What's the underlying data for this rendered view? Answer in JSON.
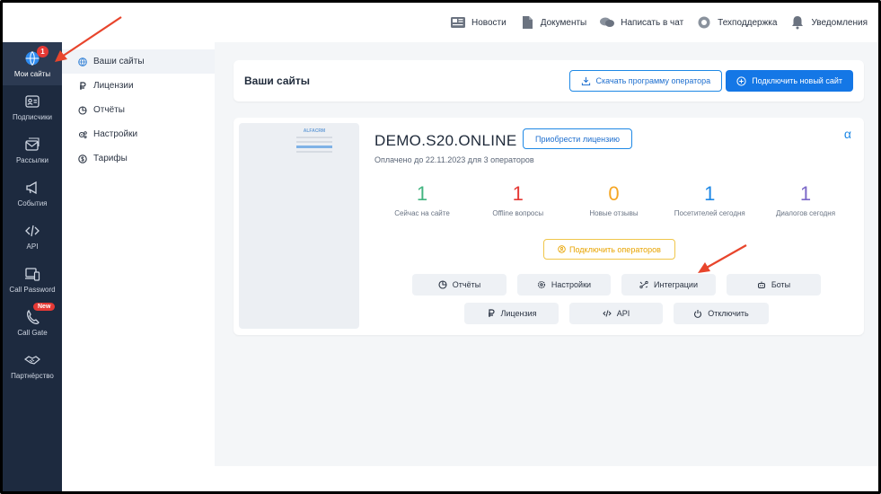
{
  "topbar": {
    "items": [
      {
        "label": "Новости",
        "icon": "news-icon"
      },
      {
        "label": "Документы",
        "icon": "document-icon"
      },
      {
        "label": "Написать в чат",
        "icon": "chat-icon"
      },
      {
        "label": "Техподдержка",
        "icon": "lifebuoy-icon"
      },
      {
        "label": "Уведомления",
        "icon": "bell-icon"
      }
    ]
  },
  "leftnav": {
    "items": [
      {
        "label": "Мои сайты",
        "icon": "globe-icon",
        "badge": "1"
      },
      {
        "label": "Подписчики",
        "icon": "contact-card-icon"
      },
      {
        "label": "Рассылки",
        "icon": "mail-icon"
      },
      {
        "label": "События",
        "icon": "megaphone-icon"
      },
      {
        "label": "API",
        "icon": "code-icon"
      },
      {
        "label": "Call Password",
        "icon": "devices-icon"
      },
      {
        "label": "Call Gate",
        "icon": "phone-icon",
        "badge": "New"
      },
      {
        "label": "Партнёрство",
        "icon": "handshake-icon"
      }
    ]
  },
  "subnav": {
    "items": [
      {
        "label": "Ваши сайты",
        "icon": "globe-icon"
      },
      {
        "label": "Лицензии",
        "icon": "ruble-icon"
      },
      {
        "label": "Отчёты",
        "icon": "pie-chart-icon"
      },
      {
        "label": "Настройки",
        "icon": "settings-icon"
      },
      {
        "label": "Тарифы",
        "icon": "dollar-icon"
      }
    ]
  },
  "header": {
    "title": "Ваши сайты",
    "download_label": "Скачать программу оператора",
    "connect_label": "Подключить новый сайт"
  },
  "site": {
    "name": "DEMO.S20.ONLINE",
    "license_button": "Приобрести лицензию",
    "alpha_icon": "α",
    "paid_until": "Оплачено до 22.11.2023 для 3 операторов",
    "preview_logo": "ALFACRM",
    "stats": [
      {
        "value": "1",
        "label": "Сейчас на сайте",
        "color": "#43b581"
      },
      {
        "value": "1",
        "label": "Offline вопросы",
        "color": "#e53935"
      },
      {
        "value": "0",
        "label": "Новые отзывы",
        "color": "#f5a623"
      },
      {
        "value": "1",
        "label": "Посетителей сегодня",
        "color": "#1e88e5"
      },
      {
        "value": "1",
        "label": "Диалогов сегодня",
        "color": "#7b68c8"
      }
    ],
    "connect_operators": "Подключить операторов",
    "actions": [
      {
        "label": "Отчёты",
        "icon": "pie-chart-icon"
      },
      {
        "label": "Настройки",
        "icon": "settings-icon"
      },
      {
        "label": "Интеграции",
        "icon": "integration-icon"
      },
      {
        "label": "Боты",
        "icon": "bot-icon"
      },
      {
        "label": "Лицензия",
        "icon": "ruble-icon"
      },
      {
        "label": "API",
        "icon": "code-icon"
      },
      {
        "label": "Отключить",
        "icon": "power-icon"
      }
    ]
  },
  "colors": {
    "sidebar": "#1d2a3f",
    "accent": "#1477e6",
    "annotation_arrow": "#e8452c"
  }
}
